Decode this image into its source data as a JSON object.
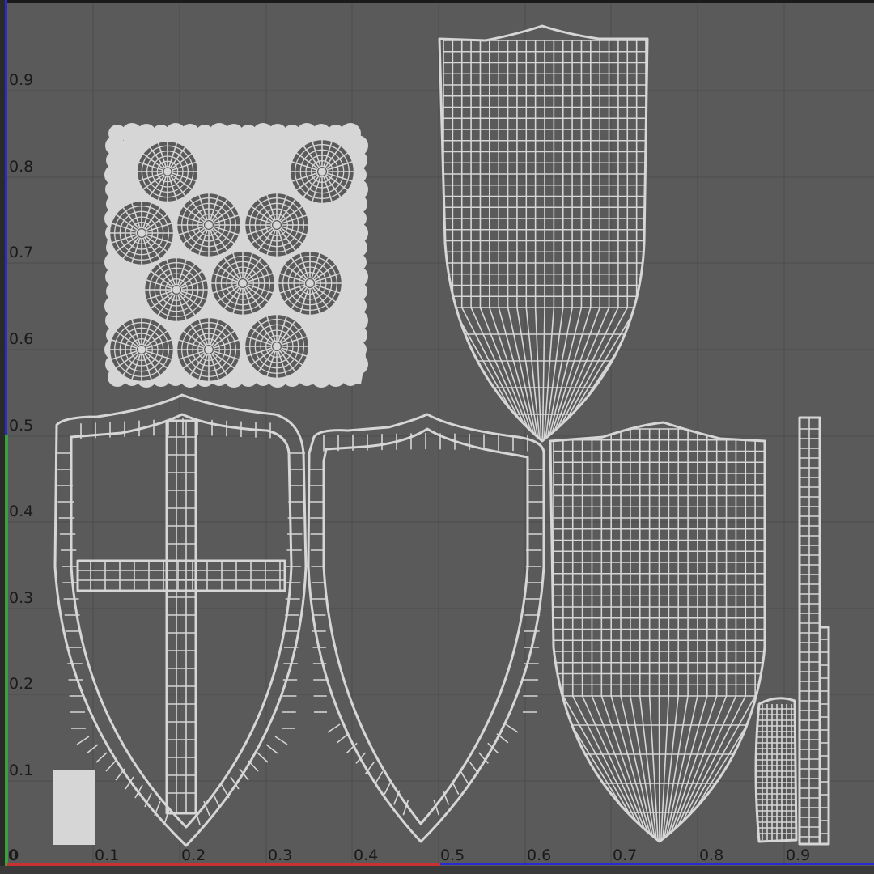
{
  "uv_editor": {
    "u_axis_labels": [
      "0",
      "0.1",
      "0.2",
      "0.3",
      "0.4",
      "0.5",
      "0.6",
      "0.7",
      "0.8",
      "0.9"
    ],
    "v_axis_labels": [
      "0.1",
      "0.2",
      "0.3",
      "0.4",
      "0.5",
      "0.6",
      "0.7",
      "0.8",
      "0.9"
    ],
    "axis_colors": {
      "u_axis": "#c83232",
      "v_axis": "#3aa03a",
      "frame_left": "#2a2ad0",
      "frame_top": "#1a1a1a",
      "background": "#5a5a5a",
      "wire": "#d6d6d6"
    },
    "uv_islands": [
      "rivet-cluster-island",
      "shield-face-with-cross-island",
      "shield-rim-island",
      "shield-back-upper-island",
      "shield-back-lower-island",
      "strap-island",
      "handle-grip-island",
      "small-block-island"
    ]
  }
}
